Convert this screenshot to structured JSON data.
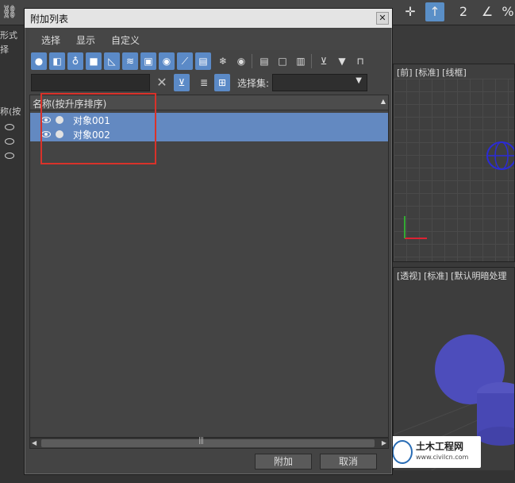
{
  "background": {
    "left_panel_lines": [
      "形式",
      "择",
      "称(按"
    ],
    "viewport_top_label": "[前] [标准] [线框]",
    "viewport_persp_label": "[透视] [标准] [默认明暗处理",
    "watermark_title": "土木工程网",
    "watermark_url": "www.civilcn.com"
  },
  "dialog": {
    "title": "附加列表",
    "close_label": "✕",
    "menu": [
      "选择",
      "显示",
      "自定义"
    ],
    "toolbar_icons": [
      "all-objects-icon",
      "geometry-icon",
      "lights-icon",
      "cameras-icon",
      "helpers-icon",
      "spacewarps-icon",
      "groups-icon",
      "xrefs-icon",
      "bones-icon",
      "containers-icon",
      "frozen-icon",
      "hidden-icon",
      "display-all-icon",
      "display-none-icon",
      "invert-icon",
      "filter-icon",
      "funnel-icon",
      "layer-icon"
    ],
    "search": {
      "value": "",
      "placeholder": ""
    },
    "clear_label": "✕",
    "selection_set_label": "选择集:",
    "selection_set_value": "",
    "list": {
      "header": "名称(按升序排序)",
      "rows": [
        {
          "label": "对象001"
        },
        {
          "label": "对象002"
        }
      ]
    },
    "buttons": {
      "attach": "附加",
      "cancel": "取消"
    },
    "accent_color": "#6389c1",
    "annotation_color": "#d9322a"
  }
}
